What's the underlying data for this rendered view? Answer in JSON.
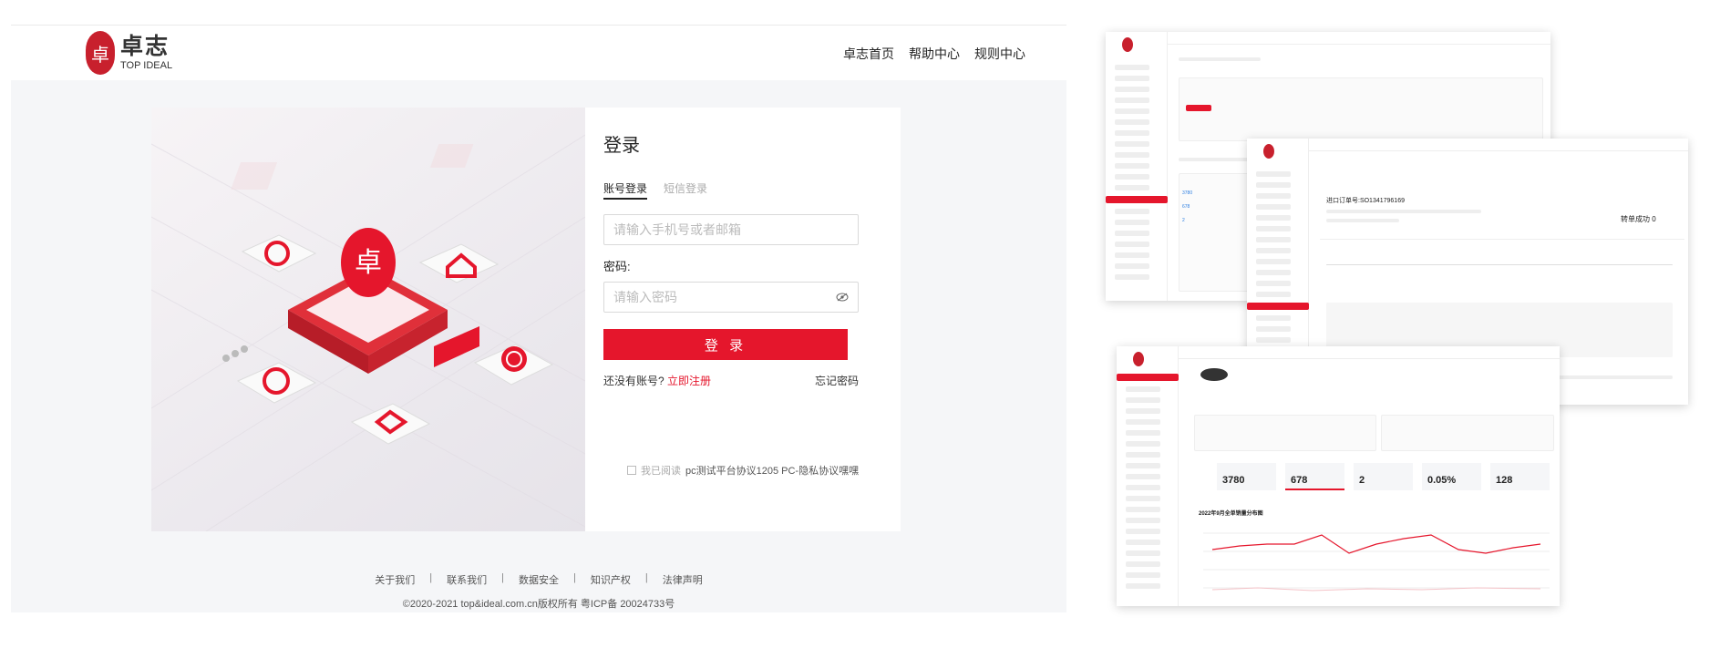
{
  "brand": {
    "logo_glyph": "卓",
    "name_cn": "卓志",
    "name_en": "TOP IDEAL",
    "accent": "#e5162c"
  },
  "nav": [
    "卓志首页",
    "帮助中心",
    "规则中心"
  ],
  "login": {
    "title": "登录",
    "tab_account": "账号登录",
    "tab_sms": "短信登录",
    "account_placeholder": "请输入手机号或者邮箱",
    "password_label": "密码:",
    "password_placeholder": "请输入密码",
    "submit": "登 录",
    "no_account": "还没有账号?",
    "register": "立即注册",
    "forgot": "忘记密码",
    "agree_prefix": "我已阅读",
    "agree_text": "pc测试平台协议1205 PC-隐私协议嘿嘿"
  },
  "footer": {
    "links": [
      "关于我们",
      "联系我们",
      "数据安全",
      "知识产权",
      "法律声明"
    ],
    "copyright": "©2020-2021 top&ideal.com.cn版权所有 粤ICP备 20024733号"
  },
  "preview3": {
    "kpis": [
      "3780",
      "678",
      "2",
      "0.05%",
      "128"
    ],
    "chart_title": "2022年9月全单销量分布图"
  },
  "preview2": {
    "title": "进口订单号:SO1341796169",
    "status": "转单成功",
    "count": "0"
  },
  "preview1": {
    "s1": "3780",
    "s2": "678",
    "s3": "2"
  }
}
